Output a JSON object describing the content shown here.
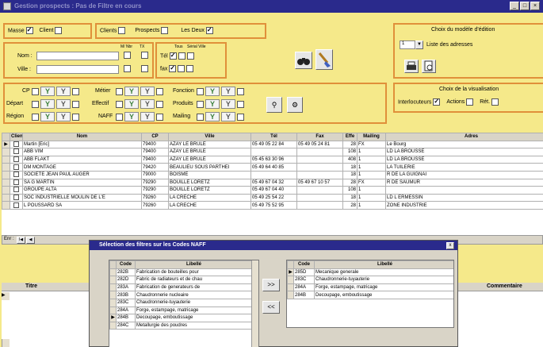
{
  "window": {
    "title": "Gestion prospects : Pas de Filtre en cours"
  },
  "masse_group": {
    "masse_label": "Masse",
    "client_label": "Client"
  },
  "type_group": {
    "clients_label": "Clients",
    "prospects_label": "Prospects",
    "les_deux_label": "Les Deux"
  },
  "search": {
    "nom_label": "Nom :",
    "ville_label": "Ville :",
    "col1": "M/ Nbr",
    "col2": "TX"
  },
  "tel_fax": {
    "col_tel": "Tous",
    "col_sel": "Sérial Ville",
    "tel_label": "Tél",
    "fax_label": "fax"
  },
  "edition": {
    "title": "Choix du modèle d'édition",
    "combo_value": "1",
    "combo_text": "Liste des adresses"
  },
  "visualisation": {
    "title": "Choix de la visualisation",
    "interlocuteurs": "Interlocuteurs",
    "actions": "Actions",
    "ret": "Rét."
  },
  "filters": {
    "cp": "CP",
    "depart": "Départ",
    "region": "Région",
    "metier": "Métier",
    "effectif": "Effectif",
    "naff": "NAFF",
    "fonction": "Fonction",
    "produits": "Produits",
    "mailing": "Mailing"
  },
  "grid": {
    "headers": [
      "Client",
      "Nom",
      "CP",
      "Ville",
      "Tél",
      "Fax",
      "Effe",
      "Mailing",
      "Adres"
    ],
    "rows": [
      [
        "",
        "Martin [Eric]",
        "79400",
        "AZAY LE BRULE",
        "05 49 05 22 84",
        "05 49 05 24 81",
        "28",
        "FX",
        "Le Bourg"
      ],
      [
        "",
        "ABB VIM",
        "79400",
        "AZAY LE BRULE",
        "",
        "",
        "108",
        "1",
        "LD LA BROUSSE"
      ],
      [
        "",
        "ABB FLAKT",
        "79400",
        "AZAY LE BRULE",
        "05 45 63 30 96",
        "",
        "408",
        "1",
        "LD LA BROUSSE"
      ],
      [
        "",
        "DM MONTAGE",
        "79420",
        "BEAULIEU SOUS PARTHEI",
        "05 49 64 40 85",
        "",
        "18",
        "1",
        "LA TUILERIE"
      ],
      [
        "",
        "SOCIETE JEAN PAUL AUGER",
        "79000",
        "BOISME",
        "",
        "",
        "18",
        "1",
        "R DE LA GUIGNAI"
      ],
      [
        "",
        "SA G MARTIN",
        "79290",
        "BOUILLE LORETZ",
        "05 49 67 04 32",
        "05 49 67 10 57",
        "28",
        "FX",
        "R DE SAUMUR"
      ],
      [
        "",
        "GROUPE ALTA",
        "79290",
        "BOUILLE LORETZ",
        "05 49 67 04 40",
        "",
        "108",
        "1",
        ""
      ],
      [
        "",
        "SOC INDUSTRIELLE MOULIN DE L'E",
        "79260",
        "LA CRECHE",
        "05 49 25 54 22",
        "",
        "18",
        "1",
        "LD L ERMESSIN"
      ],
      [
        "",
        "L POUSSARD SA",
        "79260",
        "LA CRECHE",
        "05 49 75 52 95",
        "",
        "28",
        "1",
        "ZONE INDUSTRIE"
      ]
    ]
  },
  "nav": {
    "label": "Enr :",
    "first": "I◀",
    "prev": "◀"
  },
  "lower_panel": {
    "titre_header": "Titre",
    "commentaire_header": "Commentaire"
  },
  "dialog": {
    "title": "Sélection des filtres sur les Codes NAFF",
    "left_headers": [
      "Code",
      "Libellé"
    ],
    "left_rows": [
      [
        "282B",
        "Fabrication de bouteilles pour"
      ],
      [
        "282D",
        "Fabric de radiateurs et de chau"
      ],
      [
        "283A",
        "Fabrication de generateurs de"
      ],
      [
        "283B",
        "Chaudronnerie nucleaire"
      ],
      [
        "283C",
        "Chaudronnerie-tuyauterie"
      ],
      [
        "284A",
        "Forge, estampage, matricage"
      ],
      [
        "284B",
        "Decoupage, emboutissage"
      ],
      [
        "284C",
        "Metallurgie des poudres"
      ]
    ],
    "right_headers": [
      "Code",
      "Libellé"
    ],
    "right_rows": [
      [
        "285D",
        "Mecanique generale"
      ],
      [
        "283C",
        "Chaudronnerie-tuyauterie"
      ],
      [
        "284A",
        "Forge, estampage, matricage"
      ],
      [
        "284B",
        "Decoupage, emboutissage"
      ]
    ],
    "add_label": ">>",
    "remove_label": "<<",
    "close_label": "x"
  },
  "colors": {
    "background": "#f5e98a",
    "group_border": "#e0903a",
    "titlebar": "#2a2a8c"
  }
}
